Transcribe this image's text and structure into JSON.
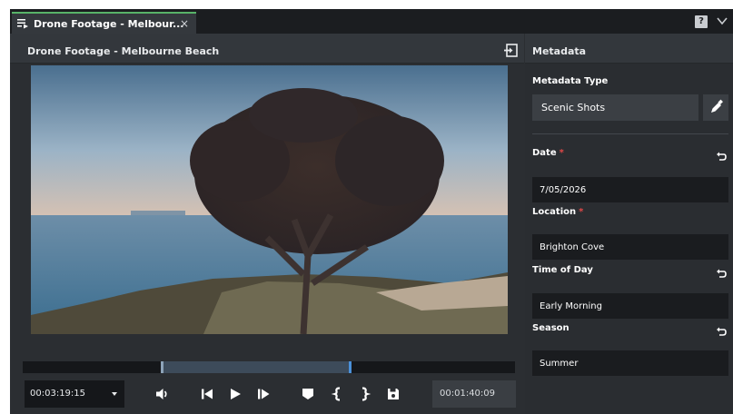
{
  "tab": {
    "title": "Drone Footage - Melbour...",
    "close": "×"
  },
  "header": {
    "help": "?"
  },
  "viewer": {
    "title": "Drone Footage - Melbourne Beach",
    "timecode_current": "00:03:19:15",
    "timecode_duration": "00:01:40:09"
  },
  "sidebar": {
    "title": "Metadata",
    "metadata_type_label": "Metadata Type",
    "metadata_type_value": "Scenic Shots",
    "fields": [
      {
        "label": "Date",
        "value": "7/05/2026",
        "required": "*"
      },
      {
        "label": "Location",
        "value": "Brighton Cove",
        "required": "*"
      },
      {
        "label": "Time of Day",
        "value": "Early Morning"
      },
      {
        "label": "Season",
        "value": "Summer"
      }
    ]
  },
  "colors": {
    "accent": "#58b368",
    "marker": "#4a90d9",
    "required": "#e04848"
  }
}
